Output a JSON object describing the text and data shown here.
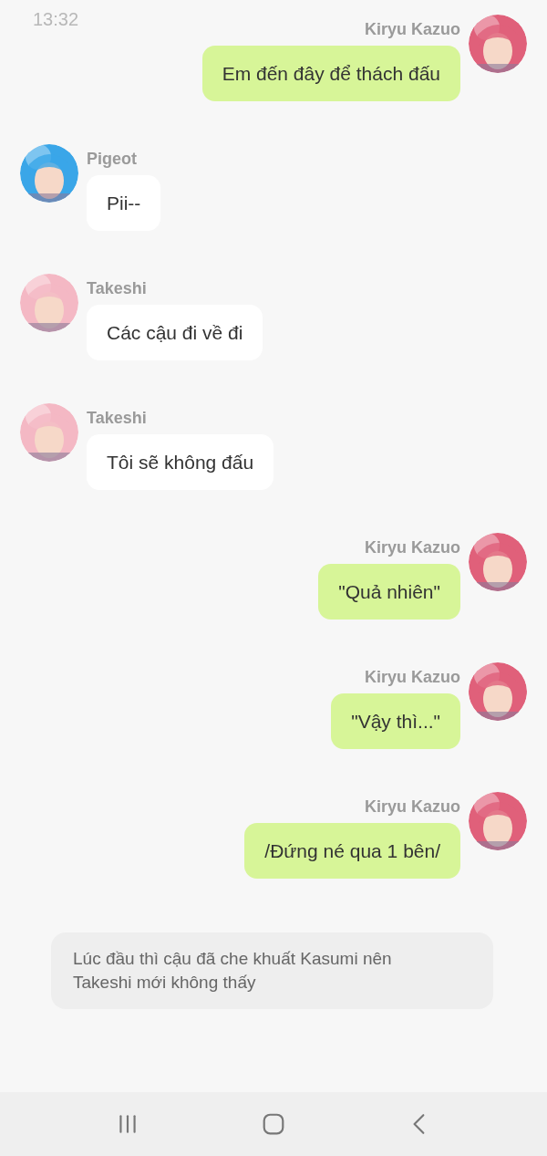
{
  "status_bar": {
    "time": "13:32"
  },
  "messages": [
    {
      "kind": "outgoing",
      "sender": "Kiryu Kazuo",
      "text": "Em đến đây để thách đấu",
      "color": "#e0607a"
    },
    {
      "kind": "incoming",
      "sender": "Pigeot",
      "text": "Pii--",
      "color": "#3aa6e8"
    },
    {
      "kind": "incoming",
      "sender": "Takeshi",
      "text": "Các cậu đi về đi",
      "color": "#f4b8c4"
    },
    {
      "kind": "incoming",
      "sender": "Takeshi",
      "text": "Tôi sẽ không đấu",
      "color": "#f4b8c4"
    },
    {
      "kind": "outgoing",
      "sender": "Kiryu Kazuo",
      "text": "\"Quả nhiên\"",
      "color": "#e0607a"
    },
    {
      "kind": "outgoing",
      "sender": "Kiryu Kazuo",
      "text": "\"Vậy thì...\"",
      "color": "#e0607a"
    },
    {
      "kind": "outgoing",
      "sender": "Kiryu Kazuo",
      "text": "/Đứng né qua 1 bên/",
      "color": "#e0607a"
    }
  ],
  "note": {
    "text": "Lúc đầu thì cậu đã che khuất Kasumi nên Takeshi mới không thấy"
  }
}
